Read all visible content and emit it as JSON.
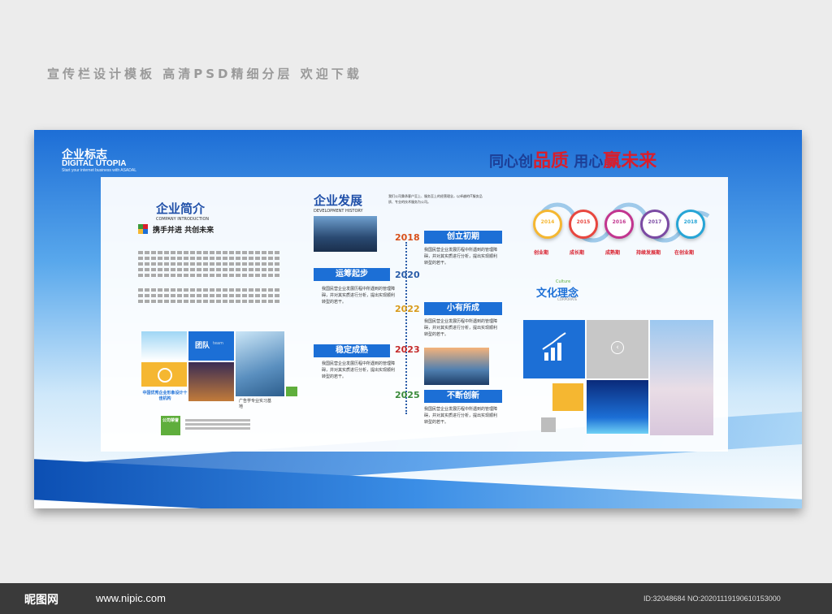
{
  "watermark_top": "宣传栏设计模板 高清PSD精细分层 欢迎下载",
  "logo": {
    "title": "企业标志",
    "subtitle": "DIGITAL UTOPIA",
    "tagline": "Start your internet business with ASADAL"
  },
  "slogan": {
    "part1": "同心创",
    "part2": "品质",
    "part3": "用心",
    "part4": "赢未来"
  },
  "intro": {
    "title": "企业简介",
    "subtitle": "COMPANY INTRODUCTION",
    "motto": "携手并进 共创未来",
    "team_label": "团队",
    "team_sub": "team",
    "caption_left": "中国优秀企业形象设计十佳机构",
    "caption_right": "广告学专业实习基地",
    "honor_label": "公司荣誉"
  },
  "development": {
    "title": "企业发展",
    "subtitle": "DEVELOPMENT HISTORY",
    "intro": "我们公司秉承客户至上、服务至上的经营理念，以卓越的IT服务品质、专业的技术服务为公司。",
    "stages": [
      {
        "year": "2018",
        "label": "创立初期",
        "color": "#d8501a"
      },
      {
        "year": "2020",
        "label": "运筹起步",
        "color": "#2a5ca8"
      },
      {
        "year": "2022",
        "label": "小有所成",
        "color": "#d89a1a"
      },
      {
        "year": "2023",
        "label": "稳定成熟",
        "color": "#c42a2a"
      },
      {
        "year": "2025",
        "label": "不断创新",
        "color": "#3a8a3a"
      }
    ],
    "desc": "我国民营企业发展历程中所遇到的管理障碍，并对其实质进行分析，提出实现顺利转型的若干。"
  },
  "culture": {
    "title": "文化理念",
    "sub": "Culture",
    "sub2": "CORPORATE",
    "years": [
      "2014",
      "2015",
      "2016",
      "2017",
      "2018"
    ],
    "year_colors": [
      "#f5b731",
      "#e8473f",
      "#c2358f",
      "#7b4aa3",
      "#27a5d6"
    ],
    "stages": [
      "创业期",
      "成长期",
      "成熟期",
      "持续发展期",
      "在创业期"
    ]
  },
  "footer": {
    "logo": "昵图网",
    "url": "www.nipic.com",
    "id": "ID:32048684 NO:20201119190610153000"
  }
}
